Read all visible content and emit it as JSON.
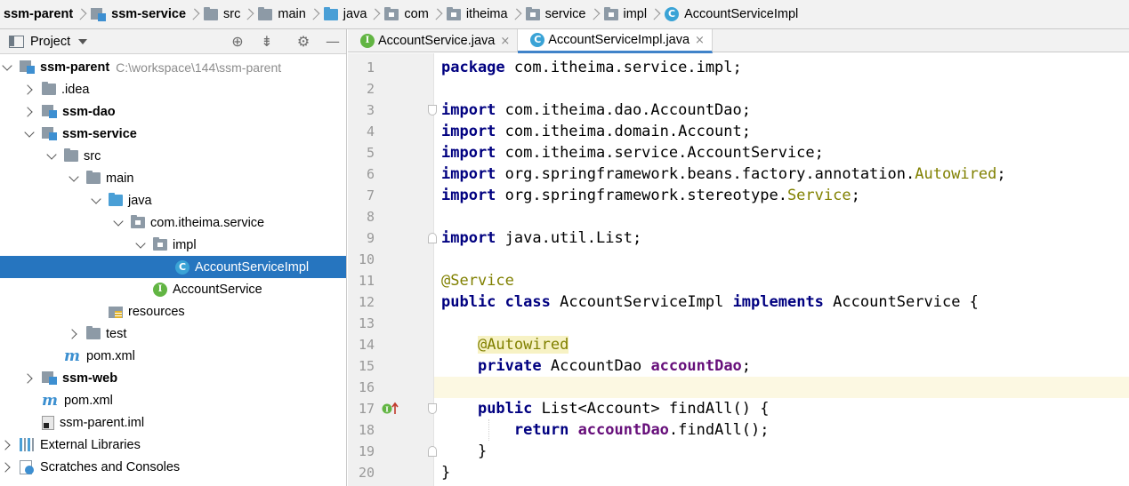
{
  "breadcrumb": [
    {
      "label": "ssm-parent",
      "icon": "none",
      "bold": true
    },
    {
      "label": "ssm-service",
      "icon": "module-icon",
      "bold": true
    },
    {
      "label": "src",
      "icon": "folder-icon",
      "bold": false
    },
    {
      "label": "main",
      "icon": "folder-icon",
      "bold": false
    },
    {
      "label": "java",
      "icon": "source-folder-icon",
      "bold": false
    },
    {
      "label": "com",
      "icon": "package-icon",
      "bold": false
    },
    {
      "label": "itheima",
      "icon": "package-icon",
      "bold": false
    },
    {
      "label": "service",
      "icon": "package-icon",
      "bold": false
    },
    {
      "label": "impl",
      "icon": "package-icon",
      "bold": false
    },
    {
      "label": "AccountServiceImpl",
      "icon": "class-icon",
      "bold": false
    }
  ],
  "project_panel": {
    "title": "Project",
    "tools": [
      "locate-icon",
      "collapse-all-icon",
      "gear-icon",
      "minimize-icon"
    ]
  },
  "tree": [
    {
      "label": "ssm-parent",
      "path": "C:\\workspace\\144\\ssm-parent",
      "icon": "module",
      "arrow": "down",
      "bold": true
    },
    {
      "label": ".idea",
      "icon": "folder",
      "arrow": "right",
      "bold": false
    },
    {
      "label": "ssm-dao",
      "icon": "module",
      "arrow": "right",
      "bold": true
    },
    {
      "label": "ssm-service",
      "icon": "module",
      "arrow": "down",
      "bold": true
    },
    {
      "label": "src",
      "icon": "folder",
      "arrow": "down",
      "bold": false
    },
    {
      "label": "main",
      "icon": "folder",
      "arrow": "down",
      "bold": false
    },
    {
      "label": "java",
      "icon": "source-folder",
      "arrow": "down",
      "bold": false
    },
    {
      "label": "com.itheima.service",
      "icon": "package",
      "arrow": "down",
      "bold": false
    },
    {
      "label": "impl",
      "icon": "package",
      "arrow": "down",
      "bold": false
    },
    {
      "label": "AccountServiceImpl",
      "icon": "class",
      "arrow": "none",
      "bold": false,
      "selected": true
    },
    {
      "label": "AccountService",
      "icon": "interface",
      "arrow": "none",
      "bold": false
    },
    {
      "label": "resources",
      "icon": "resources",
      "arrow": "none",
      "bold": false
    },
    {
      "label": "test",
      "icon": "folder",
      "arrow": "right",
      "bold": false
    },
    {
      "label": "pom.xml",
      "icon": "maven",
      "arrow": "none",
      "bold": false
    },
    {
      "label": "ssm-web",
      "icon": "module",
      "arrow": "right",
      "bold": true
    },
    {
      "label": "pom.xml",
      "icon": "maven",
      "arrow": "none",
      "bold": false
    },
    {
      "label": "ssm-parent.iml",
      "icon": "iml",
      "arrow": "none",
      "bold": false
    },
    {
      "label": "External Libraries",
      "icon": "libraries",
      "arrow": "right",
      "bold": false
    },
    {
      "label": "Scratches and Consoles",
      "icon": "scratches",
      "arrow": "right",
      "bold": false
    }
  ],
  "tabs": [
    {
      "label": "AccountService.java",
      "icon": "interface-icon",
      "active": false,
      "close": "×"
    },
    {
      "label": "AccountServiceImpl.java",
      "icon": "class-icon",
      "active": true,
      "close": "×"
    }
  ],
  "icon_letters": {
    "class": "C",
    "interface": "I",
    "maven": "m"
  },
  "current_line": 16,
  "code_lines": [
    [
      [
        "kw",
        "package"
      ],
      [
        "t",
        " com.itheima.service.impl;"
      ]
    ],
    [],
    [
      [
        "kw",
        "import"
      ],
      [
        "t",
        " com.itheima.dao.AccountDao;"
      ]
    ],
    [
      [
        "kw",
        "import"
      ],
      [
        "t",
        " com.itheima.domain.Account;"
      ]
    ],
    [
      [
        "kw",
        "import"
      ],
      [
        "t",
        " com.itheima.service.AccountService;"
      ]
    ],
    [
      [
        "kw",
        "import"
      ],
      [
        "t",
        " org.springframework.beans.factory.annotation."
      ],
      [
        "an",
        "Autowired"
      ],
      [
        "t",
        ";"
      ]
    ],
    [
      [
        "kw",
        "import"
      ],
      [
        "t",
        " org.springframework.stereotype."
      ],
      [
        "an",
        "Service"
      ],
      [
        "t",
        ";"
      ]
    ],
    [],
    [
      [
        "kw",
        "import"
      ],
      [
        "t",
        " java.util.List;"
      ]
    ],
    [],
    [
      [
        "an",
        "@Service"
      ]
    ],
    [
      [
        "kw",
        "public"
      ],
      [
        "t",
        " "
      ],
      [
        "kw",
        "class"
      ],
      [
        "t",
        " AccountServiceImpl "
      ],
      [
        "kw",
        "implements"
      ],
      [
        "t",
        " AccountService {"
      ]
    ],
    [],
    [
      [
        "t",
        "    "
      ],
      [
        "an-hl",
        "@Autowired"
      ]
    ],
    [
      [
        "t",
        "    "
      ],
      [
        "kw",
        "private"
      ],
      [
        "t",
        " AccountDao "
      ],
      [
        "fld",
        "accountDao"
      ],
      [
        "t",
        ";"
      ]
    ],
    [],
    [
      [
        "t",
        "    "
      ],
      [
        "kw",
        "public"
      ],
      [
        "t",
        " List<Account> findAll() {"
      ]
    ],
    [
      [
        "t",
        "        "
      ],
      [
        "kw",
        "return"
      ],
      [
        "t",
        " "
      ],
      [
        "fld",
        "accountDao"
      ],
      [
        "t",
        ".findAll();"
      ]
    ],
    [
      [
        "t",
        "    }"
      ]
    ],
    [
      [
        "t",
        "}"
      ]
    ]
  ]
}
